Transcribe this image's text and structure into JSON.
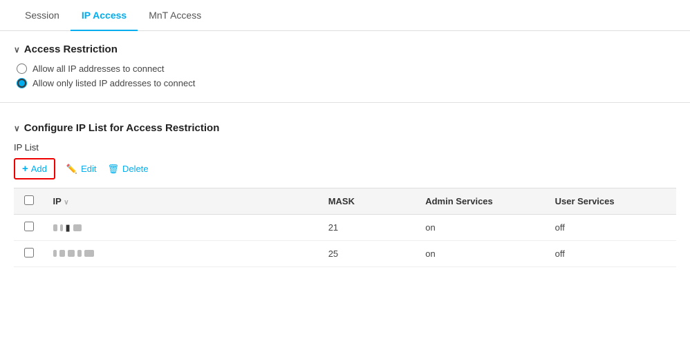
{
  "tabs": [
    {
      "id": "session",
      "label": "Session",
      "active": false
    },
    {
      "id": "ip-access",
      "label": "IP Access",
      "active": true
    },
    {
      "id": "mnt-access",
      "label": "MnT Access",
      "active": false
    }
  ],
  "access_restriction": {
    "section_title": "Access Restriction",
    "options": [
      {
        "id": "allow-all",
        "label": "Allow all IP addresses to connect",
        "checked": false
      },
      {
        "id": "allow-listed",
        "label": "Allow only listed IP addresses to connect",
        "checked": true
      }
    ]
  },
  "ip_list": {
    "section_title": "Configure IP List for Access Restriction",
    "label": "IP List",
    "toolbar": {
      "add_label": "Add",
      "edit_label": "Edit",
      "delete_label": "Delete"
    },
    "columns": [
      {
        "id": "ip",
        "label": "IP"
      },
      {
        "id": "mask",
        "label": "MASK"
      },
      {
        "id": "admin",
        "label": "Admin Services"
      },
      {
        "id": "user",
        "label": "User Services"
      }
    ],
    "rows": [
      {
        "ip_display": "redacted",
        "mask": "21",
        "admin": "on",
        "user": "off"
      },
      {
        "ip_display": "redacted2",
        "mask": "25",
        "admin": "on",
        "user": "off"
      }
    ]
  }
}
